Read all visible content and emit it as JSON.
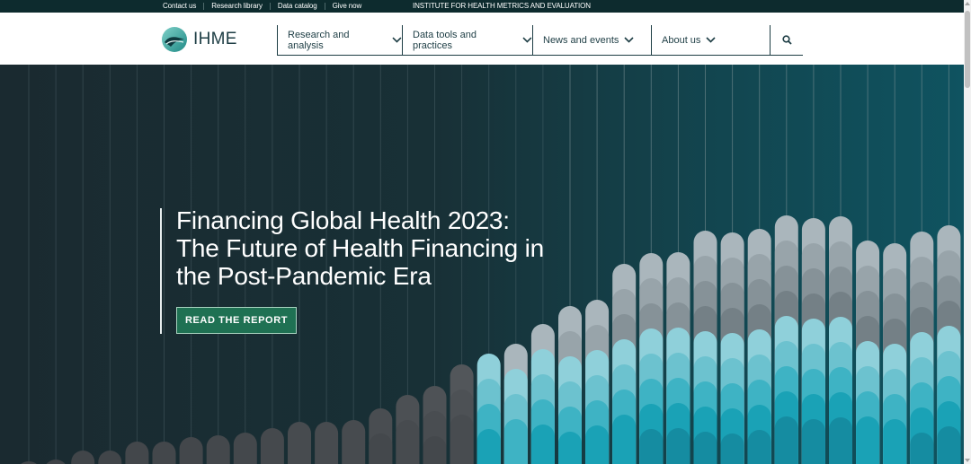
{
  "utility_bar": {
    "links": [
      "Contact us",
      "Research library",
      "Data catalog",
      "Give now"
    ],
    "org_name": "INSTITUTE FOR HEALTH METRICS AND EVALUATION"
  },
  "header": {
    "logo_text": "IHME",
    "nav": [
      {
        "label": "Research and analysis"
      },
      {
        "label": "Data tools and practices"
      },
      {
        "label": "News and events"
      },
      {
        "label": "About us"
      }
    ],
    "search_icon": "search-icon"
  },
  "hero": {
    "title": "Financing Global Health 2023: The Future of Health Financing in the Post-Pandemic Era",
    "button_label": "READ THE REPORT"
  },
  "colors": {
    "utility_bg": "#0d2b2e",
    "brand_text": "#1d3d44",
    "button_green": "#1f7153",
    "hero_dark": "#1a2a30",
    "hero_teal": "#0f5360"
  }
}
